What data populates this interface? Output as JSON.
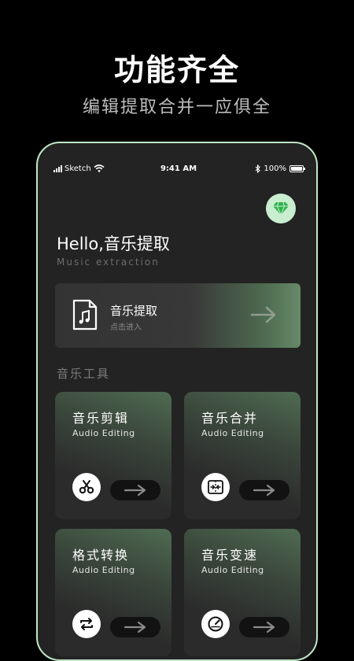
{
  "promo": {
    "headline": "功能齐全",
    "subheadline": "编辑提取合并一应俱全"
  },
  "statusbar": {
    "carrier": "Sketch",
    "time": "9:41 AM",
    "battery": "100%"
  },
  "header": {
    "greeting": "Hello,音乐提取",
    "subtitle": "Music extraction"
  },
  "banner": {
    "title": "音乐提取",
    "hint": "点击进入"
  },
  "tools": {
    "section_title": "音乐工具",
    "cards": [
      {
        "title": "音乐剪辑",
        "subtitle": "Audio Editing",
        "icon": "scissors-icon"
      },
      {
        "title": "音乐合并",
        "subtitle": "Audio Editing",
        "icon": "merge-icon"
      },
      {
        "title": "格式转换",
        "subtitle": "Audio Editing",
        "icon": "convert-icon"
      },
      {
        "title": "音乐变速",
        "subtitle": "Audio Editing",
        "icon": "speed-icon"
      }
    ]
  },
  "colors": {
    "accent": "#c9eecf",
    "accent_green": "#4f6c52",
    "phone_frame": "#bfe7c5",
    "background": "#000000",
    "screen": "#232323"
  }
}
